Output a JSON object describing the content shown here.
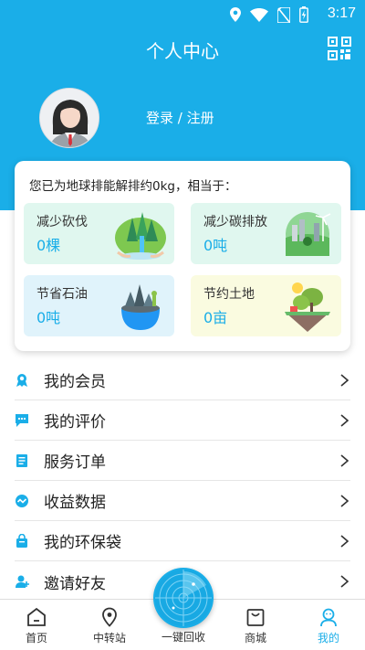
{
  "status_bar": {
    "time": "3:17"
  },
  "header": {
    "title": "个人中心",
    "login_label": "登录 / 注册"
  },
  "summary_card": {
    "text": "您已为地球排能解排约0kg，相当于：",
    "tiles": [
      {
        "title": "减少砍伐",
        "value": "0棵",
        "bg": "#e0f7ef",
        "value_color": "#1aaee8"
      },
      {
        "title": "减少碳排放",
        "value": "0吨",
        "bg": "#e0f7ef",
        "value_color": "#1aaee8"
      },
      {
        "title": "节省石油",
        "value": "0吨",
        "bg": "#e0f3fb",
        "value_color": "#1aaee8"
      },
      {
        "title": "节约土地",
        "value": "0亩",
        "bg": "#fafbe0",
        "value_color": "#1aaee8"
      }
    ]
  },
  "menu": {
    "items": [
      {
        "label": "我的会员",
        "icon": "member-icon"
      },
      {
        "label": "我的评价",
        "icon": "comment-icon"
      },
      {
        "label": "服务订单",
        "icon": "order-icon"
      },
      {
        "label": "收益数据",
        "icon": "earnings-icon"
      },
      {
        "label": "我的环保袋",
        "icon": "bag-icon"
      },
      {
        "label": "邀请好友",
        "icon": "invite-icon"
      }
    ]
  },
  "tabbar": {
    "tabs": [
      {
        "label": "首页",
        "icon": "home-icon"
      },
      {
        "label": "中转站",
        "icon": "location-pin-icon"
      },
      {
        "label": "一键回收",
        "icon": "radar-icon"
      },
      {
        "label": "商城",
        "icon": "shop-bag-icon"
      },
      {
        "label": "我的",
        "icon": "profile-icon"
      }
    ],
    "active": "我的"
  },
  "colors": {
    "accent": "#1aaee8",
    "text": "#222222",
    "divider": "#e6e6e6"
  }
}
